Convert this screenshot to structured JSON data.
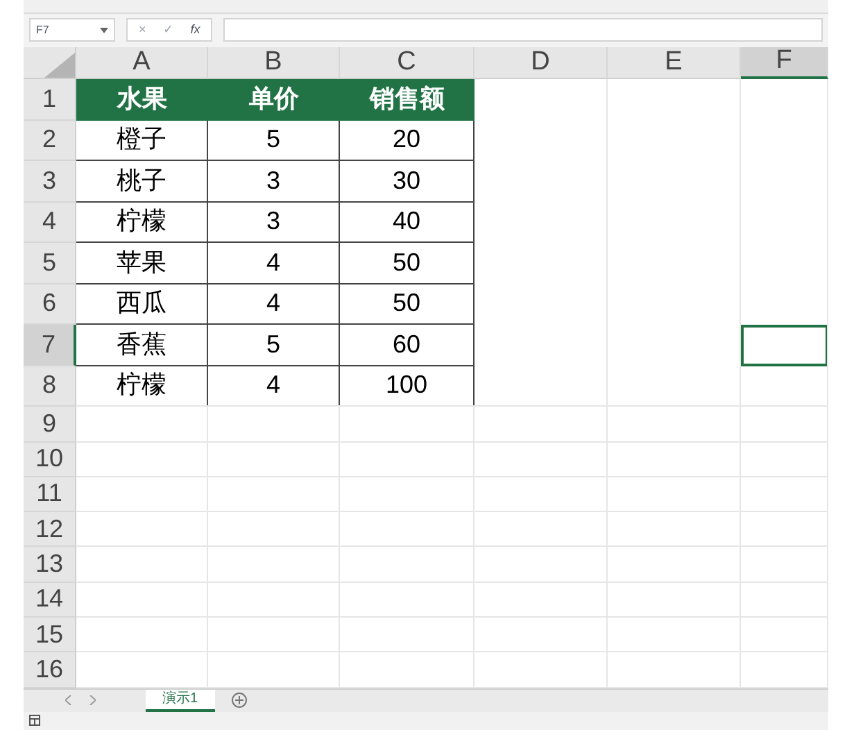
{
  "name_box": "F7",
  "formula_bar": {
    "cancel": "×",
    "enter": "✓",
    "function": "fx"
  },
  "columns": [
    {
      "label": "A",
      "selected": false
    },
    {
      "label": "B",
      "selected": false
    },
    {
      "label": "C",
      "selected": false
    },
    {
      "label": "D",
      "selected": false
    },
    {
      "label": "E",
      "selected": false
    },
    {
      "label": "F",
      "selected": true
    }
  ],
  "rows": [
    {
      "label": "1",
      "selected": false,
      "cells": [
        "水果",
        "单价",
        "销售额"
      ],
      "kind": "header"
    },
    {
      "label": "2",
      "selected": false,
      "cells": [
        "橙子",
        "5",
        "20"
      ],
      "kind": "data"
    },
    {
      "label": "3",
      "selected": false,
      "cells": [
        "桃子",
        "3",
        "30"
      ],
      "kind": "data"
    },
    {
      "label": "4",
      "selected": false,
      "cells": [
        "柠檬",
        "3",
        "40"
      ],
      "kind": "data"
    },
    {
      "label": "5",
      "selected": false,
      "cells": [
        "苹果",
        "4",
        "50"
      ],
      "kind": "data"
    },
    {
      "label": "6",
      "selected": false,
      "cells": [
        "西瓜",
        "4",
        "50"
      ],
      "kind": "data"
    },
    {
      "label": "7",
      "selected": true,
      "cells": [
        "香蕉",
        "5",
        "60"
      ],
      "kind": "data"
    },
    {
      "label": "8",
      "selected": false,
      "cells": [
        "柠檬",
        "4",
        "100"
      ],
      "kind": "data"
    },
    {
      "label": "9",
      "selected": false,
      "cells": [],
      "kind": "empty"
    },
    {
      "label": "10",
      "selected": false,
      "cells": [],
      "kind": "empty"
    },
    {
      "label": "11",
      "selected": false,
      "cells": [],
      "kind": "empty"
    },
    {
      "label": "12",
      "selected": false,
      "cells": [],
      "kind": "empty"
    },
    {
      "label": "13",
      "selected": false,
      "cells": [],
      "kind": "empty"
    },
    {
      "label": "14",
      "selected": false,
      "cells": [],
      "kind": "empty"
    },
    {
      "label": "15",
      "selected": false,
      "cells": [],
      "kind": "empty"
    },
    {
      "label": "16",
      "selected": false,
      "cells": [],
      "kind": "empty"
    }
  ],
  "sheet_tabs": [
    {
      "label": "演示1",
      "selected": true
    }
  ]
}
